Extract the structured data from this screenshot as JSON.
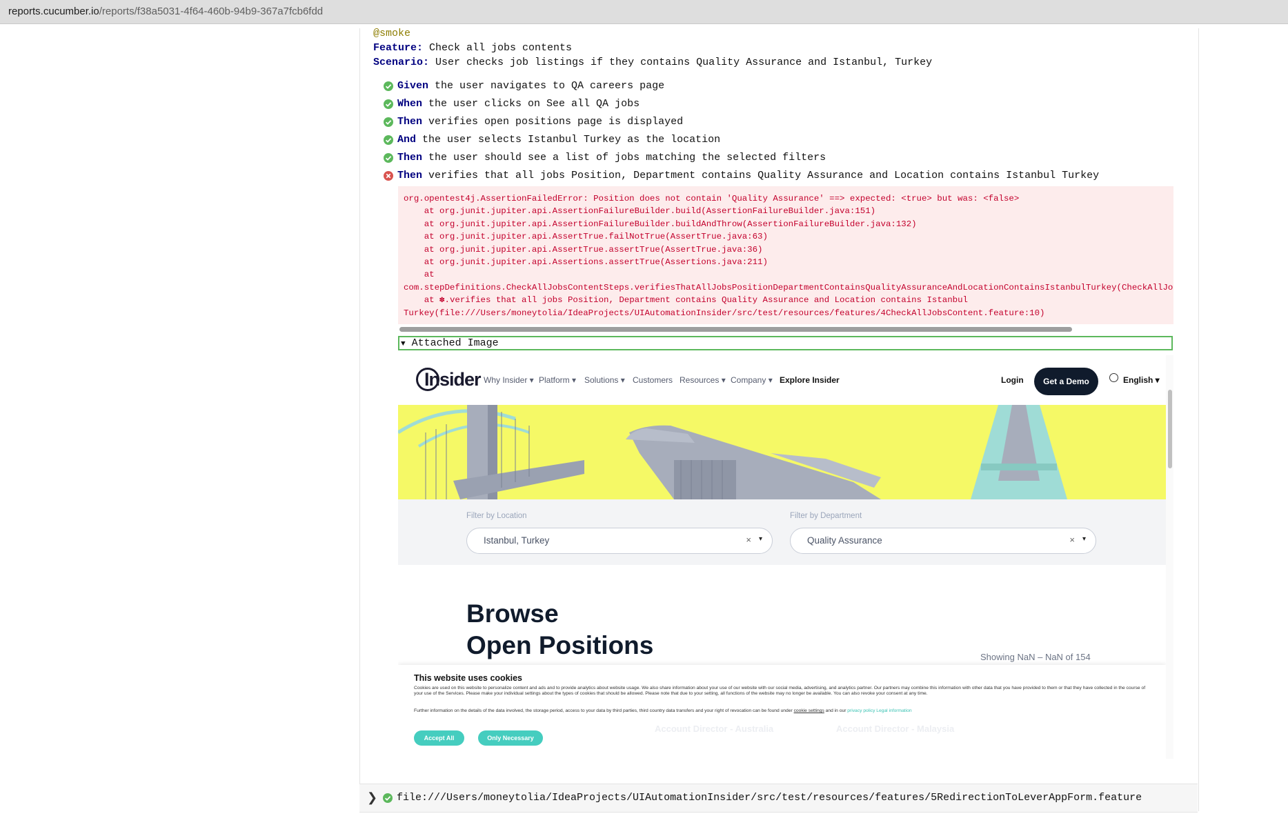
{
  "browser": {
    "url_host": "reports.cucumber.io",
    "url_path": "/reports/f38a5031-4f64-460b-94b9-367a7fcb6fdd"
  },
  "report": {
    "tag": "@smoke",
    "feature_keyword": "Feature:",
    "feature_name": " Check all jobs contents",
    "scenario_keyword": "Scenario:",
    "scenario_name": " User checks job listings if they contains Quality Assurance and Istanbul, Turkey",
    "steps": [
      {
        "keyword": "Given",
        "text": " the user navigates to QA careers page",
        "status": "passed"
      },
      {
        "keyword": "When",
        "text": " the user clicks on See all QA jobs",
        "status": "passed"
      },
      {
        "keyword": "Then",
        "text": " verifies open positions page is displayed",
        "status": "passed"
      },
      {
        "keyword": "And",
        "text": " the user selects Istanbul Turkey as the location",
        "status": "passed"
      },
      {
        "keyword": "Then",
        "text": " the user should see a list of jobs matching the selected filters",
        "status": "passed"
      },
      {
        "keyword": "Then",
        "text": " verifies that all jobs Position, Department contains Quality Assurance and Location contains Istanbul Turkey",
        "status": "failed"
      }
    ],
    "error_lines": [
      "org.opentest4j.AssertionFailedError: Position does not contain 'Quality Assurance' ==> expected: <true> but was: <false>",
      "    at org.junit.jupiter.api.AssertionFailureBuilder.build(AssertionFailureBuilder.java:151)",
      "    at org.junit.jupiter.api.AssertionFailureBuilder.buildAndThrow(AssertionFailureBuilder.java:132)",
      "    at org.junit.jupiter.api.AssertTrue.failNotTrue(AssertTrue.java:63)",
      "    at org.junit.jupiter.api.AssertTrue.assertTrue(AssertTrue.java:36)",
      "    at org.junit.jupiter.api.Assertions.assertTrue(Assertions.java:211)",
      "    at",
      "com.stepDefinitions.CheckAllJobsContentSteps.verifiesThatAllJobsPositionDepartmentContainsQualityAssuranceAndLocationContainsIstanbulTurkey(CheckAllJobs",
      "    at ✽.verifies that all jobs Position, Department contains Quality Assurance and Location contains Istanbul",
      "Turkey(file:///Users/moneytolia/IdeaProjects/UIAutomationInsider/src/test/resources/features/4CheckAllJobsContent.feature:10)"
    ],
    "attachment_label": "Attached Image",
    "next_feature_path": "file:///Users/moneytolia/IdeaProjects/UIAutomationInsider/src/test/resources/features/5RedirectionToLeverAppForm.feature"
  },
  "attached_screenshot": {
    "logo_text": "Insider",
    "nav_items": [
      "Why Insider ▾",
      "Platform ▾",
      "Solutions ▾",
      "Customers",
      "Resources ▾",
      "Company ▾",
      "Explore Insider"
    ],
    "login": "Login",
    "demo_button": "Get a Demo",
    "language": "English ▾",
    "filter_location_label": "Filter by Location",
    "filter_location_value": "Istanbul, Turkey",
    "filter_department_label": "Filter by Department",
    "filter_department_value": "Quality Assurance",
    "clear_glyph": "×",
    "caret_glyph": "▾",
    "browse_line1": "Browse",
    "browse_line2": "Open Positions",
    "showing": "Showing NaN – NaN of 154",
    "cookie_title": "This website uses cookies",
    "cookie_body": "Cookies are used on this website to personalize content and ads and to provide analytics about website usage. We also share information about your use of our website with our social media, advertising, and analytics partner. Our partners may combine this information with other data that you have provided to them or that they have collected in the course of your use of the Services. Please make your individual settings about the types of cookies that should be allowed. Please note that due to your setting, all functions of the website may no longer be available. You can also revoke your consent at any time.",
    "cookie_more_prefix": "Further information on the details of the data involved, the storage period, access to your data by third parties, third country data transfers and your right of revocation can be found under ",
    "cookie_settings_link": "cookie settings",
    "cookie_more_mid": " and in our ",
    "privacy_link": "privacy policy",
    "legal_link": "Legal information",
    "accept_all": "Accept All",
    "only_necessary": "Only Necessary",
    "ghost_job_1": "Account Director - Australia",
    "ghost_job_2": "Account Director - Malaysia"
  },
  "colors": {
    "keyword": "#000080",
    "pass": "#5cb85c",
    "fail": "#d9534f",
    "error_bg": "#fdecec",
    "error_text": "#c3002c",
    "hero_yellow": "#f5f966",
    "demo_button": "#101b2c",
    "cookie_button": "#45cdbf"
  }
}
